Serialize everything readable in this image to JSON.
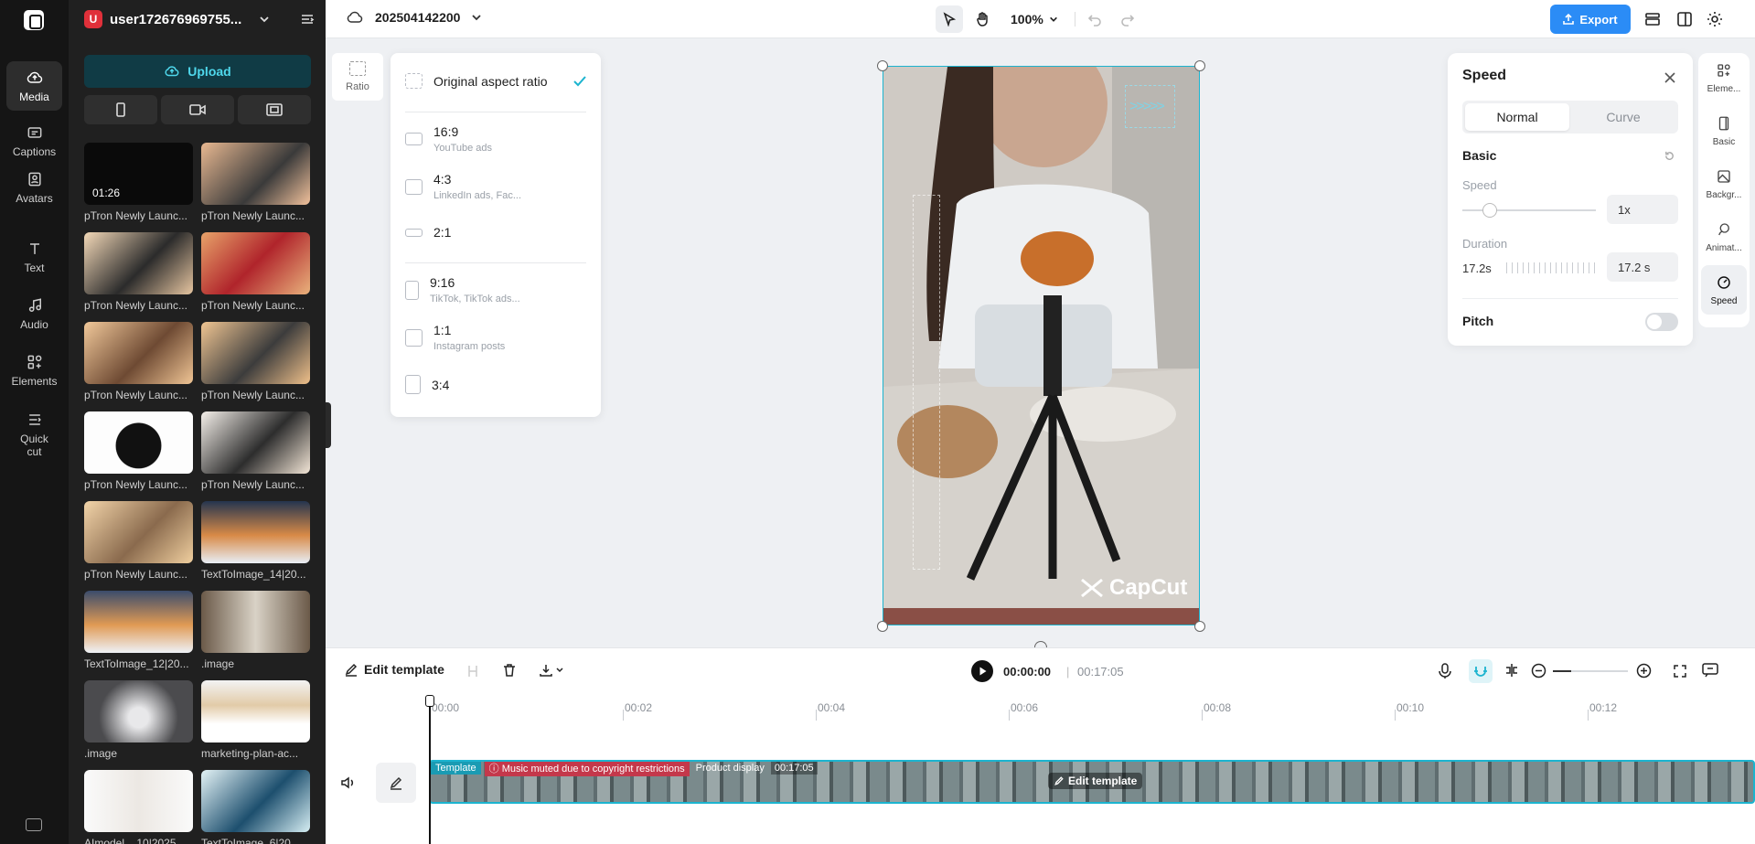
{
  "sidebar": {
    "items": [
      {
        "label": "Media",
        "icon": "cloud-upload-icon"
      },
      {
        "label": "Captions",
        "icon": "captions-icon"
      },
      {
        "label": "Avatars",
        "icon": "avatar-icon"
      },
      {
        "label": "Text",
        "icon": "text-icon"
      },
      {
        "label": "Audio",
        "icon": "music-note-icon"
      },
      {
        "label": "Elements",
        "icon": "elements-icon"
      },
      {
        "label": "Quick cut",
        "icon": "quick-cut-icon"
      }
    ]
  },
  "media_panel": {
    "avatar_letter": "U",
    "username": "user172676969755...",
    "upload_label": "Upload",
    "tiles": [
      {
        "name": "pTron Newly Launc...",
        "duration": "01:26"
      },
      {
        "name": "pTron Newly Launc..."
      },
      {
        "name": "pTron Newly Launc..."
      },
      {
        "name": "pTron Newly Launc..."
      },
      {
        "name": "pTron Newly Launc..."
      },
      {
        "name": "pTron Newly Launc..."
      },
      {
        "name": "pTron Newly Launc..."
      },
      {
        "name": "pTron Newly Launc..."
      },
      {
        "name": "pTron Newly Launc..."
      },
      {
        "name": "TextToImage_14|20..."
      },
      {
        "name": "TextToImage_12|20..."
      },
      {
        "name": ".image"
      },
      {
        "name": ".image"
      },
      {
        "name": "marketing-plan-ac..."
      },
      {
        "name": "AImodel__10|2025..."
      },
      {
        "name": "TextToImage_6|20..."
      }
    ]
  },
  "topbar": {
    "project_name": "202504142200",
    "zoom": "100%",
    "export_label": "Export"
  },
  "ratio": {
    "side_label": "Ratio",
    "options": [
      {
        "label": "Original aspect ratio",
        "sub": ""
      },
      {
        "label": "16:9",
        "sub": "YouTube ads"
      },
      {
        "label": "4:3",
        "sub": "LinkedIn ads, Fac..."
      },
      {
        "label": "2:1",
        "sub": ""
      },
      {
        "label": "9:16",
        "sub": "TikTok, TikTok ads..."
      },
      {
        "label": "1:1",
        "sub": "Instagram posts"
      },
      {
        "label": "3:4",
        "sub": ""
      }
    ]
  },
  "canvas": {
    "watermark": "CapCut"
  },
  "speed_panel": {
    "title": "Speed",
    "tab_normal": "Normal",
    "tab_curve": "Curve",
    "section": "Basic",
    "speed_label": "Speed",
    "speed_value": "1x",
    "duration_label": "Duration",
    "duration_text": "17.2s",
    "duration_value": "17.2 s",
    "pitch_label": "Pitch"
  },
  "side_tabs": [
    {
      "label": "Eleme...",
      "icon": "elements-icon"
    },
    {
      "label": "Basic",
      "icon": "basic-icon"
    },
    {
      "label": "Backgr...",
      "icon": "background-icon"
    },
    {
      "label": "Animat...",
      "icon": "animation-icon"
    },
    {
      "label": "Speed",
      "icon": "speed-icon"
    }
  ],
  "timeline": {
    "edit_template": "Edit template",
    "current_time": "00:00:00",
    "total_time": "00:17:05",
    "ticks": [
      "00:00",
      "00:02",
      "00:04",
      "00:06",
      "00:08",
      "00:10",
      "00:12"
    ],
    "clip_tag": "Template",
    "clip_warning": "Music muted due to copyright restrictions",
    "clip_name": "Product display",
    "clip_duration": "00:17:05",
    "clip_edit": "Edit template"
  }
}
